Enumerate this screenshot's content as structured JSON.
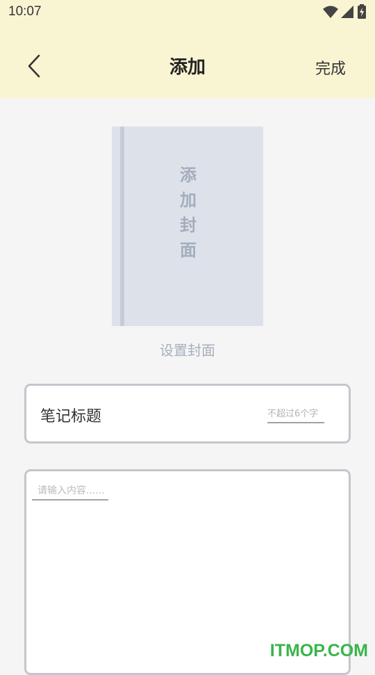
{
  "status_bar": {
    "time": "10:07",
    "icons": [
      "wifi-icon",
      "cellular-signal-icon",
      "battery-charging-icon"
    ]
  },
  "header": {
    "back_icon": "chevron-left-icon",
    "title": "添加",
    "done_label": "完成"
  },
  "cover": {
    "text": "添加封面",
    "caption": "设置封面"
  },
  "title_field": {
    "label": "笔记标题",
    "placeholder": "不超过6个字",
    "value": ""
  },
  "content_field": {
    "placeholder": "请输入内容......",
    "value": ""
  },
  "watermark": {
    "text": "ITMOP.COM"
  },
  "colors": {
    "header_bg": "#f9f5d3",
    "page_bg": "#f5f5f5",
    "cover_bg": "#dde2ea",
    "cover_text": "#a3adbd",
    "card_border": "#c3c6cc",
    "watermark": "#39b54a"
  }
}
